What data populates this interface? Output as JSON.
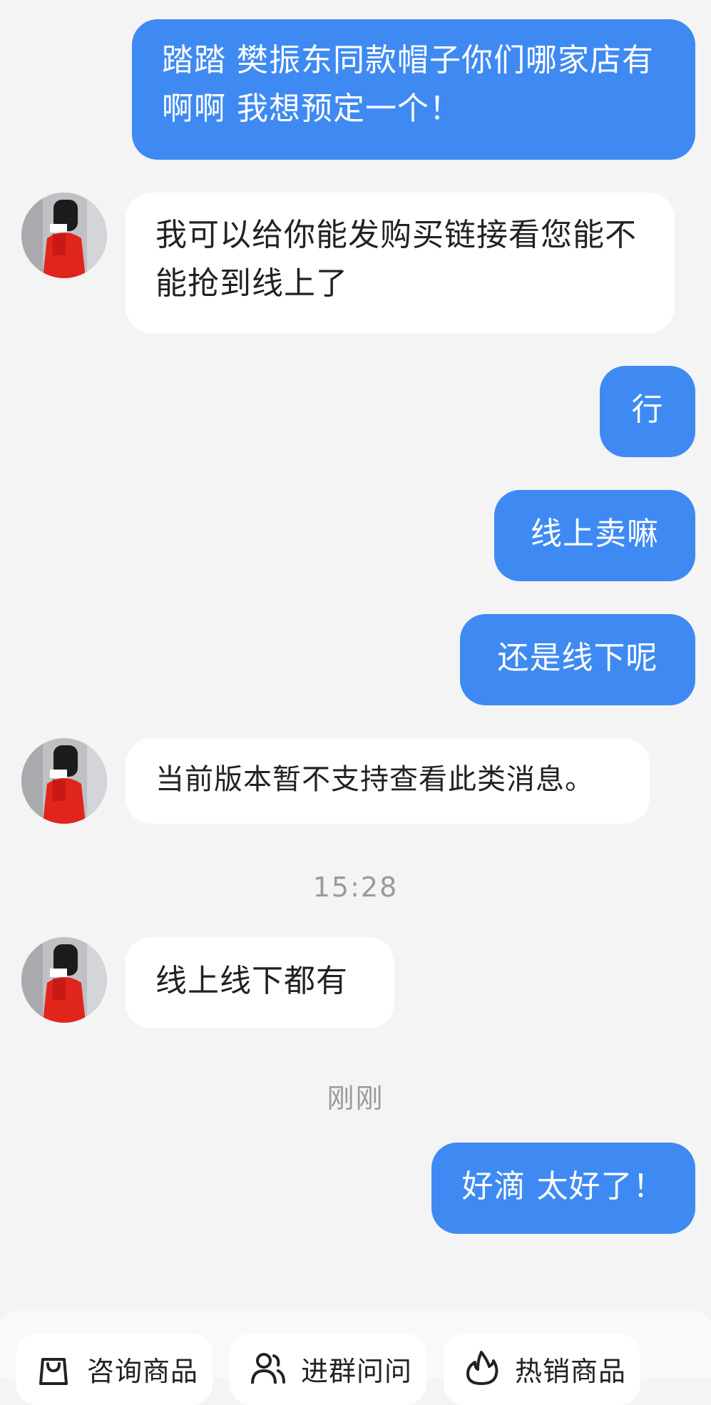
{
  "conversation": {
    "messages": [
      {
        "side": "out",
        "text": "踏踏 樊振东同款帽子你们哪家店有啊啊 我想预定一个！"
      },
      {
        "side": "in",
        "text": "我可以给你能发购买链接看您能不能抢到线上了"
      },
      {
        "side": "out",
        "text": "行"
      },
      {
        "side": "out",
        "text": "线上卖嘛"
      },
      {
        "side": "out",
        "text": "还是线下呢"
      },
      {
        "side": "in",
        "text": "当前版本暂不支持查看此类消息。"
      },
      {
        "side": "in",
        "text": "线上线下都有"
      },
      {
        "side": "out",
        "text": "好滴 太好了！"
      }
    ],
    "timestamps": [
      "15:28",
      "刚刚"
    ]
  },
  "quick_actions": [
    {
      "label": "咨询商品",
      "icon": "shopping-bag-icon"
    },
    {
      "label": "进群问问",
      "icon": "group-users-icon"
    },
    {
      "label": "热销商品",
      "icon": "flame-icon"
    }
  ],
  "colors": {
    "outgoing_bubble": "#3f8af2",
    "incoming_bubble": "#ffffff",
    "background": "#f4f4f4",
    "timestamp": "#9a9a9a"
  }
}
